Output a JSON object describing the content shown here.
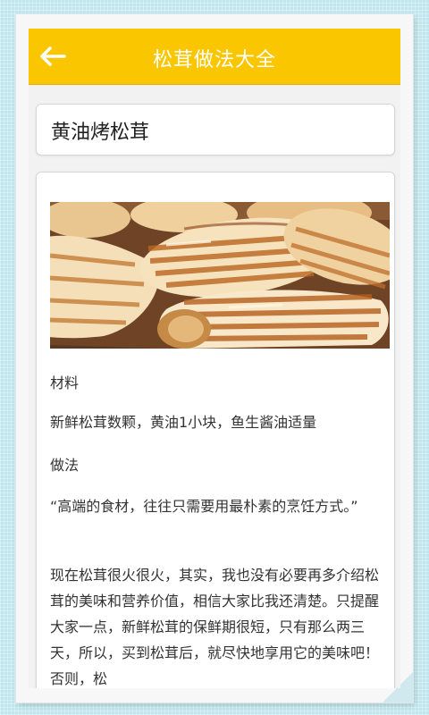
{
  "header": {
    "title": "松茸做法大全",
    "back_icon": "arrow-left-icon"
  },
  "recipe": {
    "title": "黄油烤松茸",
    "image": "grilled-matsutake-photo",
    "paragraphs": [
      "材料",
      "新鲜松茸数颗，黄油1小块，鱼生酱油适量",
      "做法",
      "“高端的食材，往往只需要用最朴素的烹饪方式。”",
      "现在松茸很火很火，其实，我也没有必要再多介绍松茸的美味和营养价值，相信大家比我还清楚。只提醒大家一点，新鲜松茸的保鲜期很短，只有那么两三天，所以，买到松茸后，就尽快地享用它的美味吧！否则，松"
    ]
  },
  "colors": {
    "header_bg": "#f9c600",
    "header_text": "#ffffff",
    "background": "#bfe6ee"
  }
}
